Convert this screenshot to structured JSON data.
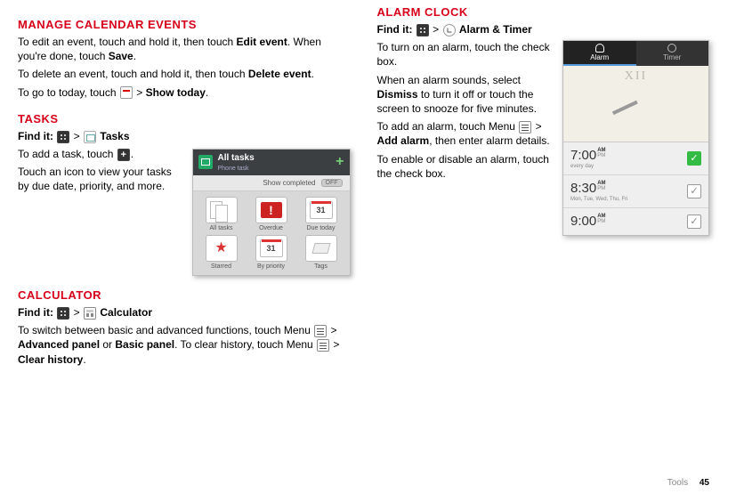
{
  "left": {
    "manage": {
      "title": "MANAGE CALENDAR EVENTS",
      "p1a": "To edit an event, touch and hold it, then touch ",
      "p1b": "Edit event",
      "p1c": ". When you're done, touch ",
      "p1d": "Save",
      "p1e": ".",
      "p2a": "To delete an event, touch and hold it, then touch ",
      "p2b": "Delete event",
      "p2c": ".",
      "p3a": "To go to today, touch ",
      "p3b": "Show today",
      "p3c": "."
    },
    "tasks": {
      "title": "TASKS",
      "find_label": "Find it:",
      "find_app": "Tasks",
      "p1a": "To add a task, touch ",
      "p1b": ".",
      "p2": "Touch an icon to view your tasks by due date, priority, and more."
    },
    "calc": {
      "title": "CALCULATOR",
      "find_label": "Find it:",
      "find_app": "Calculator",
      "p1a": "To switch between basic and advanced functions, touch Menu ",
      "p1b": "Advanced panel",
      "p1c": " or ",
      "p1d": "Basic panel",
      "p1e": ". To clear history, touch Menu ",
      "p1f": "Clear history",
      "p1g": "."
    }
  },
  "right": {
    "alarm": {
      "title": "ALARM CLOCK",
      "find_label": "Find it:",
      "find_app": "Alarm & Timer",
      "p1": "To turn on an alarm, touch the check box.",
      "p2a": "When an alarm sounds, select ",
      "p2b": "Dismiss",
      "p2c": " to turn it off or touch the screen to snooze for five minutes.",
      "p3a": "To add an alarm, touch Menu ",
      "p3b": "Add alarm",
      "p3c": ", then enter alarm details.",
      "p4": "To enable or disable an alarm, touch the check box."
    }
  },
  "tasks_widget": {
    "header_title": "All tasks",
    "header_sub": "Phone task",
    "show_completed": "Show completed",
    "off": "OFF",
    "cells": [
      "All tasks",
      "Overdue",
      "Due today",
      "Starred",
      "By priority",
      "Tags"
    ]
  },
  "alarm_widget": {
    "tabs": [
      "Alarm",
      "Timer"
    ],
    "rows": [
      {
        "time": "7:00",
        "am": "AM",
        "pm": "PM",
        "days": "every day",
        "on": true
      },
      {
        "time": "8:30",
        "am": "AM",
        "pm": "PM",
        "days": "Mon, Tue, Wed, Thu, Fri",
        "on": false
      },
      {
        "time": "9:00",
        "am": "AM",
        "pm": "PM",
        "days": "",
        "on": false
      }
    ]
  },
  "gt": ">",
  "footer": {
    "section": "Tools",
    "page": "45"
  }
}
